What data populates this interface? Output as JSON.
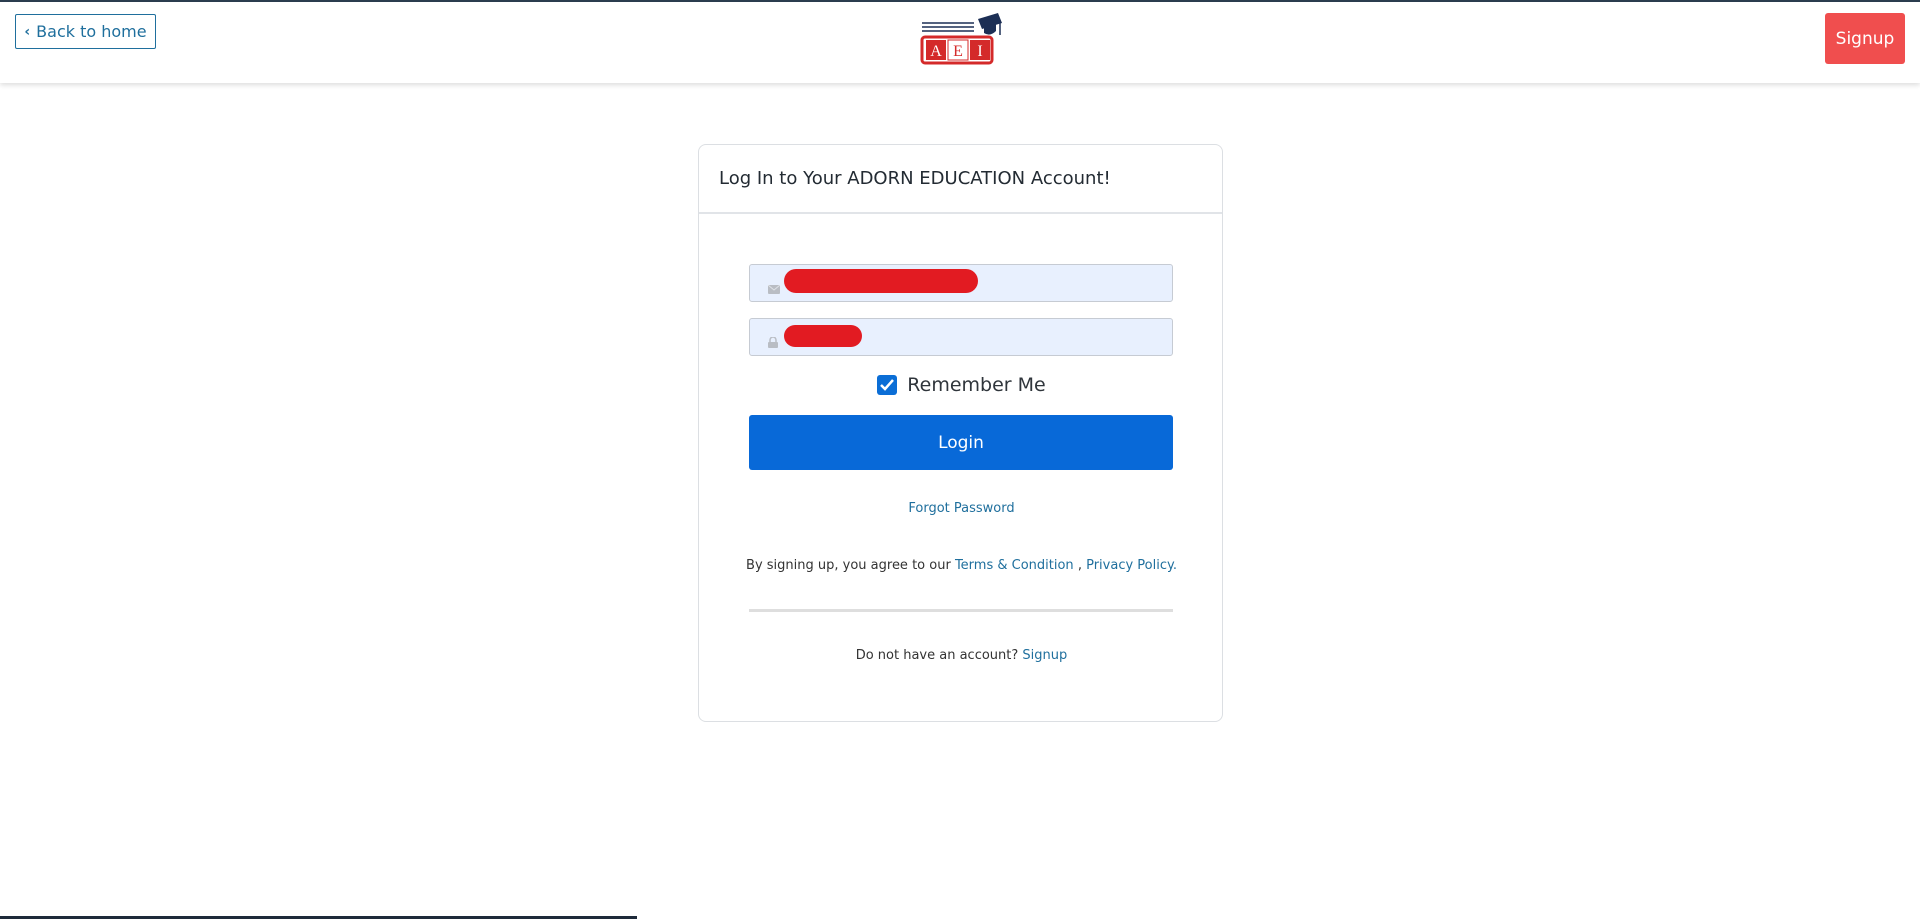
{
  "header": {
    "back_label": "Back to home",
    "signup_label": "Signup",
    "logo_letters": [
      "A",
      "E",
      "I"
    ]
  },
  "login": {
    "title": "Log In to Your ADORN EDUCATION Account!",
    "email_field": {
      "icon": "envelope-icon",
      "value": ""
    },
    "password_field": {
      "icon": "lock-icon",
      "value": ""
    },
    "remember_label": "Remember Me",
    "remember_checked": true,
    "login_button": "Login",
    "forgot_password": "Forgot Password",
    "terms_prefix": "By signing up, you agree to our",
    "terms_link": "Terms & Condition",
    "terms_separator": ",",
    "privacy_link": "Privacy Policy.",
    "no_account_text": "Do not have an account?",
    "signup_link": "Signup"
  },
  "colors": {
    "accent_blue": "#0869d8",
    "link_blue": "#1f6f9d",
    "signup_red": "#f04e4e",
    "field_bg": "#e8f0fe",
    "redaction_red": "#e21b22"
  }
}
